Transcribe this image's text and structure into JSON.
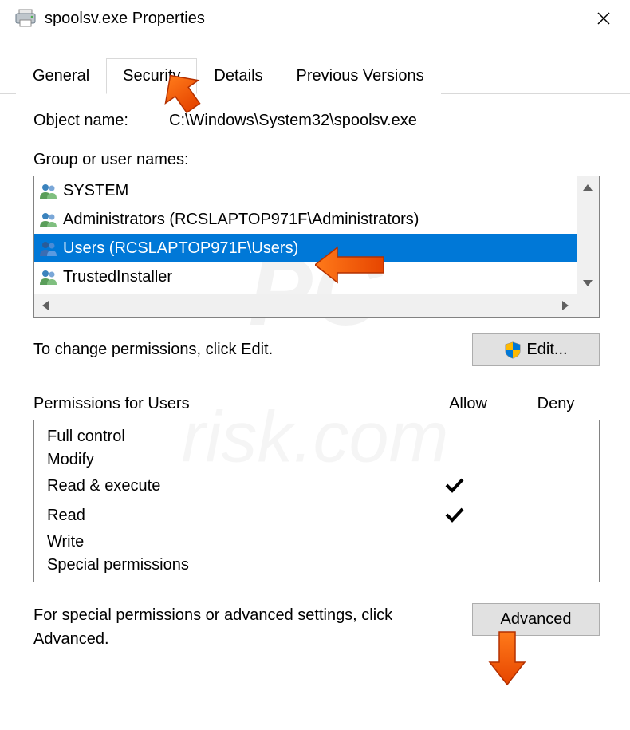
{
  "titlebar": {
    "title": "spoolsv.exe Properties"
  },
  "tabs": {
    "general": "General",
    "security": "Security",
    "details": "Details",
    "previous": "Previous Versions"
  },
  "object": {
    "label": "Object name:",
    "path": "C:\\Windows\\System32\\spoolsv.exe"
  },
  "group_label": "Group or user names:",
  "groups": [
    {
      "name": "SYSTEM"
    },
    {
      "name": "Administrators (RCSLAPTOP971F\\Administrators)"
    },
    {
      "name": "Users (RCSLAPTOP971F\\Users)"
    },
    {
      "name": "TrustedInstaller"
    }
  ],
  "change_perm_text": "To change permissions, click Edit.",
  "edit_button": "Edit...",
  "perm_for": "Permissions for Users",
  "allow_label": "Allow",
  "deny_label": "Deny",
  "perms": [
    {
      "name": "Full control",
      "allow": false,
      "deny": false
    },
    {
      "name": "Modify",
      "allow": false,
      "deny": false
    },
    {
      "name": "Read & execute",
      "allow": true,
      "deny": false
    },
    {
      "name": "Read",
      "allow": true,
      "deny": false
    },
    {
      "name": "Write",
      "allow": false,
      "deny": false
    },
    {
      "name": "Special permissions",
      "allow": false,
      "deny": false
    }
  ],
  "advanced_text": "For special permissions or advanced settings, click Advanced.",
  "advanced_button": "Advanced"
}
